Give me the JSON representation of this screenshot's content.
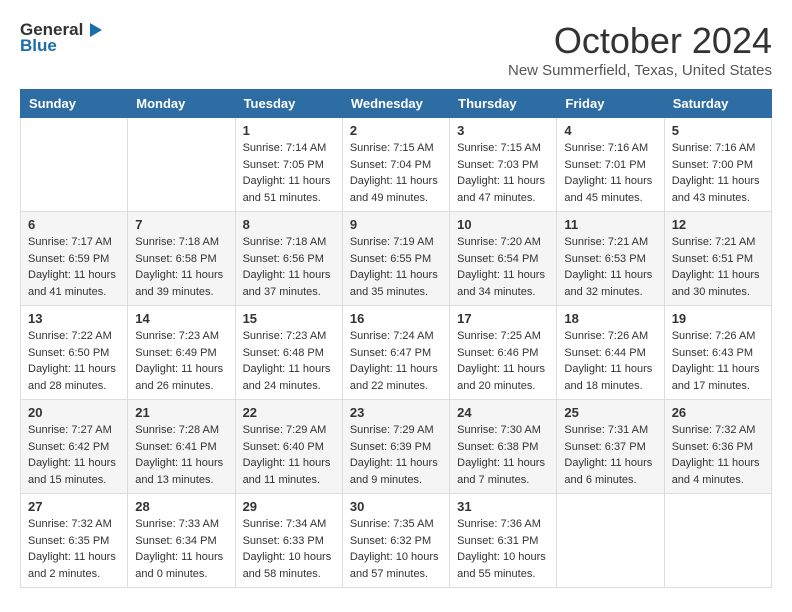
{
  "header": {
    "logo_general": "General",
    "logo_blue": "Blue",
    "title": "October 2024",
    "subtitle": "New Summerfield, Texas, United States"
  },
  "weekdays": [
    "Sunday",
    "Monday",
    "Tuesday",
    "Wednesday",
    "Thursday",
    "Friday",
    "Saturday"
  ],
  "weeks": [
    [
      {
        "day": "",
        "info": ""
      },
      {
        "day": "",
        "info": ""
      },
      {
        "day": "1",
        "info": "Sunrise: 7:14 AM\nSunset: 7:05 PM\nDaylight: 11 hours and 51 minutes."
      },
      {
        "day": "2",
        "info": "Sunrise: 7:15 AM\nSunset: 7:04 PM\nDaylight: 11 hours and 49 minutes."
      },
      {
        "day": "3",
        "info": "Sunrise: 7:15 AM\nSunset: 7:03 PM\nDaylight: 11 hours and 47 minutes."
      },
      {
        "day": "4",
        "info": "Sunrise: 7:16 AM\nSunset: 7:01 PM\nDaylight: 11 hours and 45 minutes."
      },
      {
        "day": "5",
        "info": "Sunrise: 7:16 AM\nSunset: 7:00 PM\nDaylight: 11 hours and 43 minutes."
      }
    ],
    [
      {
        "day": "6",
        "info": "Sunrise: 7:17 AM\nSunset: 6:59 PM\nDaylight: 11 hours and 41 minutes."
      },
      {
        "day": "7",
        "info": "Sunrise: 7:18 AM\nSunset: 6:58 PM\nDaylight: 11 hours and 39 minutes."
      },
      {
        "day": "8",
        "info": "Sunrise: 7:18 AM\nSunset: 6:56 PM\nDaylight: 11 hours and 37 minutes."
      },
      {
        "day": "9",
        "info": "Sunrise: 7:19 AM\nSunset: 6:55 PM\nDaylight: 11 hours and 35 minutes."
      },
      {
        "day": "10",
        "info": "Sunrise: 7:20 AM\nSunset: 6:54 PM\nDaylight: 11 hours and 34 minutes."
      },
      {
        "day": "11",
        "info": "Sunrise: 7:21 AM\nSunset: 6:53 PM\nDaylight: 11 hours and 32 minutes."
      },
      {
        "day": "12",
        "info": "Sunrise: 7:21 AM\nSunset: 6:51 PM\nDaylight: 11 hours and 30 minutes."
      }
    ],
    [
      {
        "day": "13",
        "info": "Sunrise: 7:22 AM\nSunset: 6:50 PM\nDaylight: 11 hours and 28 minutes."
      },
      {
        "day": "14",
        "info": "Sunrise: 7:23 AM\nSunset: 6:49 PM\nDaylight: 11 hours and 26 minutes."
      },
      {
        "day": "15",
        "info": "Sunrise: 7:23 AM\nSunset: 6:48 PM\nDaylight: 11 hours and 24 minutes."
      },
      {
        "day": "16",
        "info": "Sunrise: 7:24 AM\nSunset: 6:47 PM\nDaylight: 11 hours and 22 minutes."
      },
      {
        "day": "17",
        "info": "Sunrise: 7:25 AM\nSunset: 6:46 PM\nDaylight: 11 hours and 20 minutes."
      },
      {
        "day": "18",
        "info": "Sunrise: 7:26 AM\nSunset: 6:44 PM\nDaylight: 11 hours and 18 minutes."
      },
      {
        "day": "19",
        "info": "Sunrise: 7:26 AM\nSunset: 6:43 PM\nDaylight: 11 hours and 17 minutes."
      }
    ],
    [
      {
        "day": "20",
        "info": "Sunrise: 7:27 AM\nSunset: 6:42 PM\nDaylight: 11 hours and 15 minutes."
      },
      {
        "day": "21",
        "info": "Sunrise: 7:28 AM\nSunset: 6:41 PM\nDaylight: 11 hours and 13 minutes."
      },
      {
        "day": "22",
        "info": "Sunrise: 7:29 AM\nSunset: 6:40 PM\nDaylight: 11 hours and 11 minutes."
      },
      {
        "day": "23",
        "info": "Sunrise: 7:29 AM\nSunset: 6:39 PM\nDaylight: 11 hours and 9 minutes."
      },
      {
        "day": "24",
        "info": "Sunrise: 7:30 AM\nSunset: 6:38 PM\nDaylight: 11 hours and 7 minutes."
      },
      {
        "day": "25",
        "info": "Sunrise: 7:31 AM\nSunset: 6:37 PM\nDaylight: 11 hours and 6 minutes."
      },
      {
        "day": "26",
        "info": "Sunrise: 7:32 AM\nSunset: 6:36 PM\nDaylight: 11 hours and 4 minutes."
      }
    ],
    [
      {
        "day": "27",
        "info": "Sunrise: 7:32 AM\nSunset: 6:35 PM\nDaylight: 11 hours and 2 minutes."
      },
      {
        "day": "28",
        "info": "Sunrise: 7:33 AM\nSunset: 6:34 PM\nDaylight: 11 hours and 0 minutes."
      },
      {
        "day": "29",
        "info": "Sunrise: 7:34 AM\nSunset: 6:33 PM\nDaylight: 10 hours and 58 minutes."
      },
      {
        "day": "30",
        "info": "Sunrise: 7:35 AM\nSunset: 6:32 PM\nDaylight: 10 hours and 57 minutes."
      },
      {
        "day": "31",
        "info": "Sunrise: 7:36 AM\nSunset: 6:31 PM\nDaylight: 10 hours and 55 minutes."
      },
      {
        "day": "",
        "info": ""
      },
      {
        "day": "",
        "info": ""
      }
    ]
  ]
}
